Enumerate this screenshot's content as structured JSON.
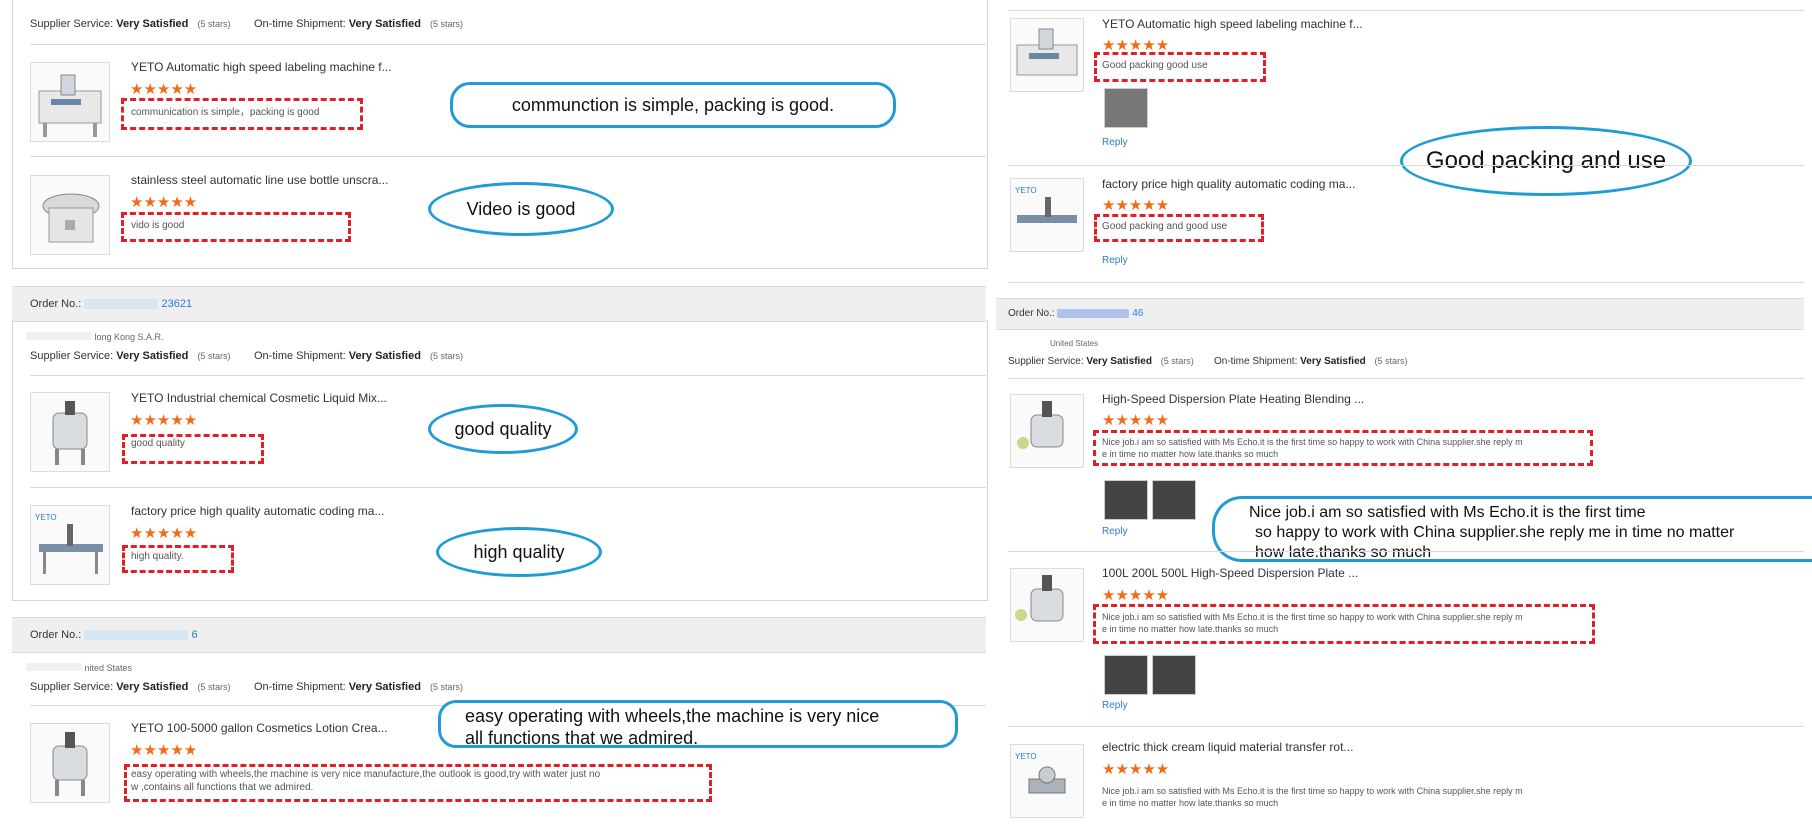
{
  "common": {
    "supplier_label": "Supplier Service:",
    "shipment_label": "On-time Shipment:",
    "rating_value": "Very Satisfied",
    "rating_stars": "(5 stars)",
    "reply": "Reply",
    "stars": "★★★★★",
    "order_label": "Order No.:"
  },
  "left": {
    "orders": [
      {
        "order_no": "",
        "location": "",
        "products": [
          {
            "title": "YETO Automatic high speed labeling machine f...",
            "review": "communication is simple，packing is good",
            "callout": "communction is simple, packing is good."
          },
          {
            "title": "stainless steel automatic line use bottle unscra...",
            "review": "vido is good",
            "callout": "Video is good"
          }
        ]
      },
      {
        "order_no": "23621",
        "location": "long Kong S.A.R.",
        "products": [
          {
            "title": "YETO Industrial chemical Cosmetic Liquid Mix...",
            "review": "good quality",
            "callout": "good quality"
          },
          {
            "title": "factory price high quality automatic coding ma...",
            "review": "high quality.",
            "callout": "high quality"
          }
        ]
      },
      {
        "order_no": "6",
        "location": "nited States",
        "products": [
          {
            "title": "YETO 100-5000 gallon Cosmetics Lotion Crea...",
            "review_line1": "easy operating with wheels,the machine is very nice manufacture,the outlook is good,try with water just no",
            "review_line2": "w ,contains all functions that we admired.",
            "callout_line1": "easy operating with wheels,the machine is very nice",
            "callout_line2": "all functions that we admired."
          }
        ]
      }
    ]
  },
  "right": {
    "products_top": [
      {
        "title": "YETO Automatic high speed labeling machine f...",
        "review": "Good packing good use"
      },
      {
        "title": "factory price high quality automatic coding ma...",
        "review": "Good packing and good use"
      }
    ],
    "callout_top": "Good packing and use",
    "order": {
      "order_no": "46",
      "location": "United States"
    },
    "products_bottom": [
      {
        "title": "High-Speed Dispersion Plate Heating Blending ...",
        "review_line1": "Nice job.i am so satisfied with Ms Echo.it is the first time so happy to work with China supplier.she reply m",
        "review_line2": "e in time no matter how late.thanks so much"
      },
      {
        "title": "100L 200L 500L High-Speed Dispersion Plate ...",
        "review_line1": "Nice job.i am so satisfied with Ms Echo.it is the first time so happy to work with China supplier.she reply m",
        "review_line2": "e in time no matter how late.thanks so much"
      },
      {
        "title": "electric thick cream liquid material transfer rot...",
        "review_line1": "Nice job.i am so satisfied with Ms Echo.it is the first time so happy to work with China supplier.she reply m",
        "review_line2": "e in time no matter how late.thanks so much"
      }
    ],
    "callout_bottom": {
      "line1": "Nice job.i am so satisfied with Ms Echo.it is the first time",
      "line2": "so happy to work with China supplier.she reply me in time no matter",
      "line3": "how late.thanks so much"
    }
  },
  "colors": {
    "accent_blue": "#1f9bd6",
    "dash_red": "#e41e26",
    "star_orange": "#f26b16",
    "link_blue": "#2b7bd6"
  }
}
